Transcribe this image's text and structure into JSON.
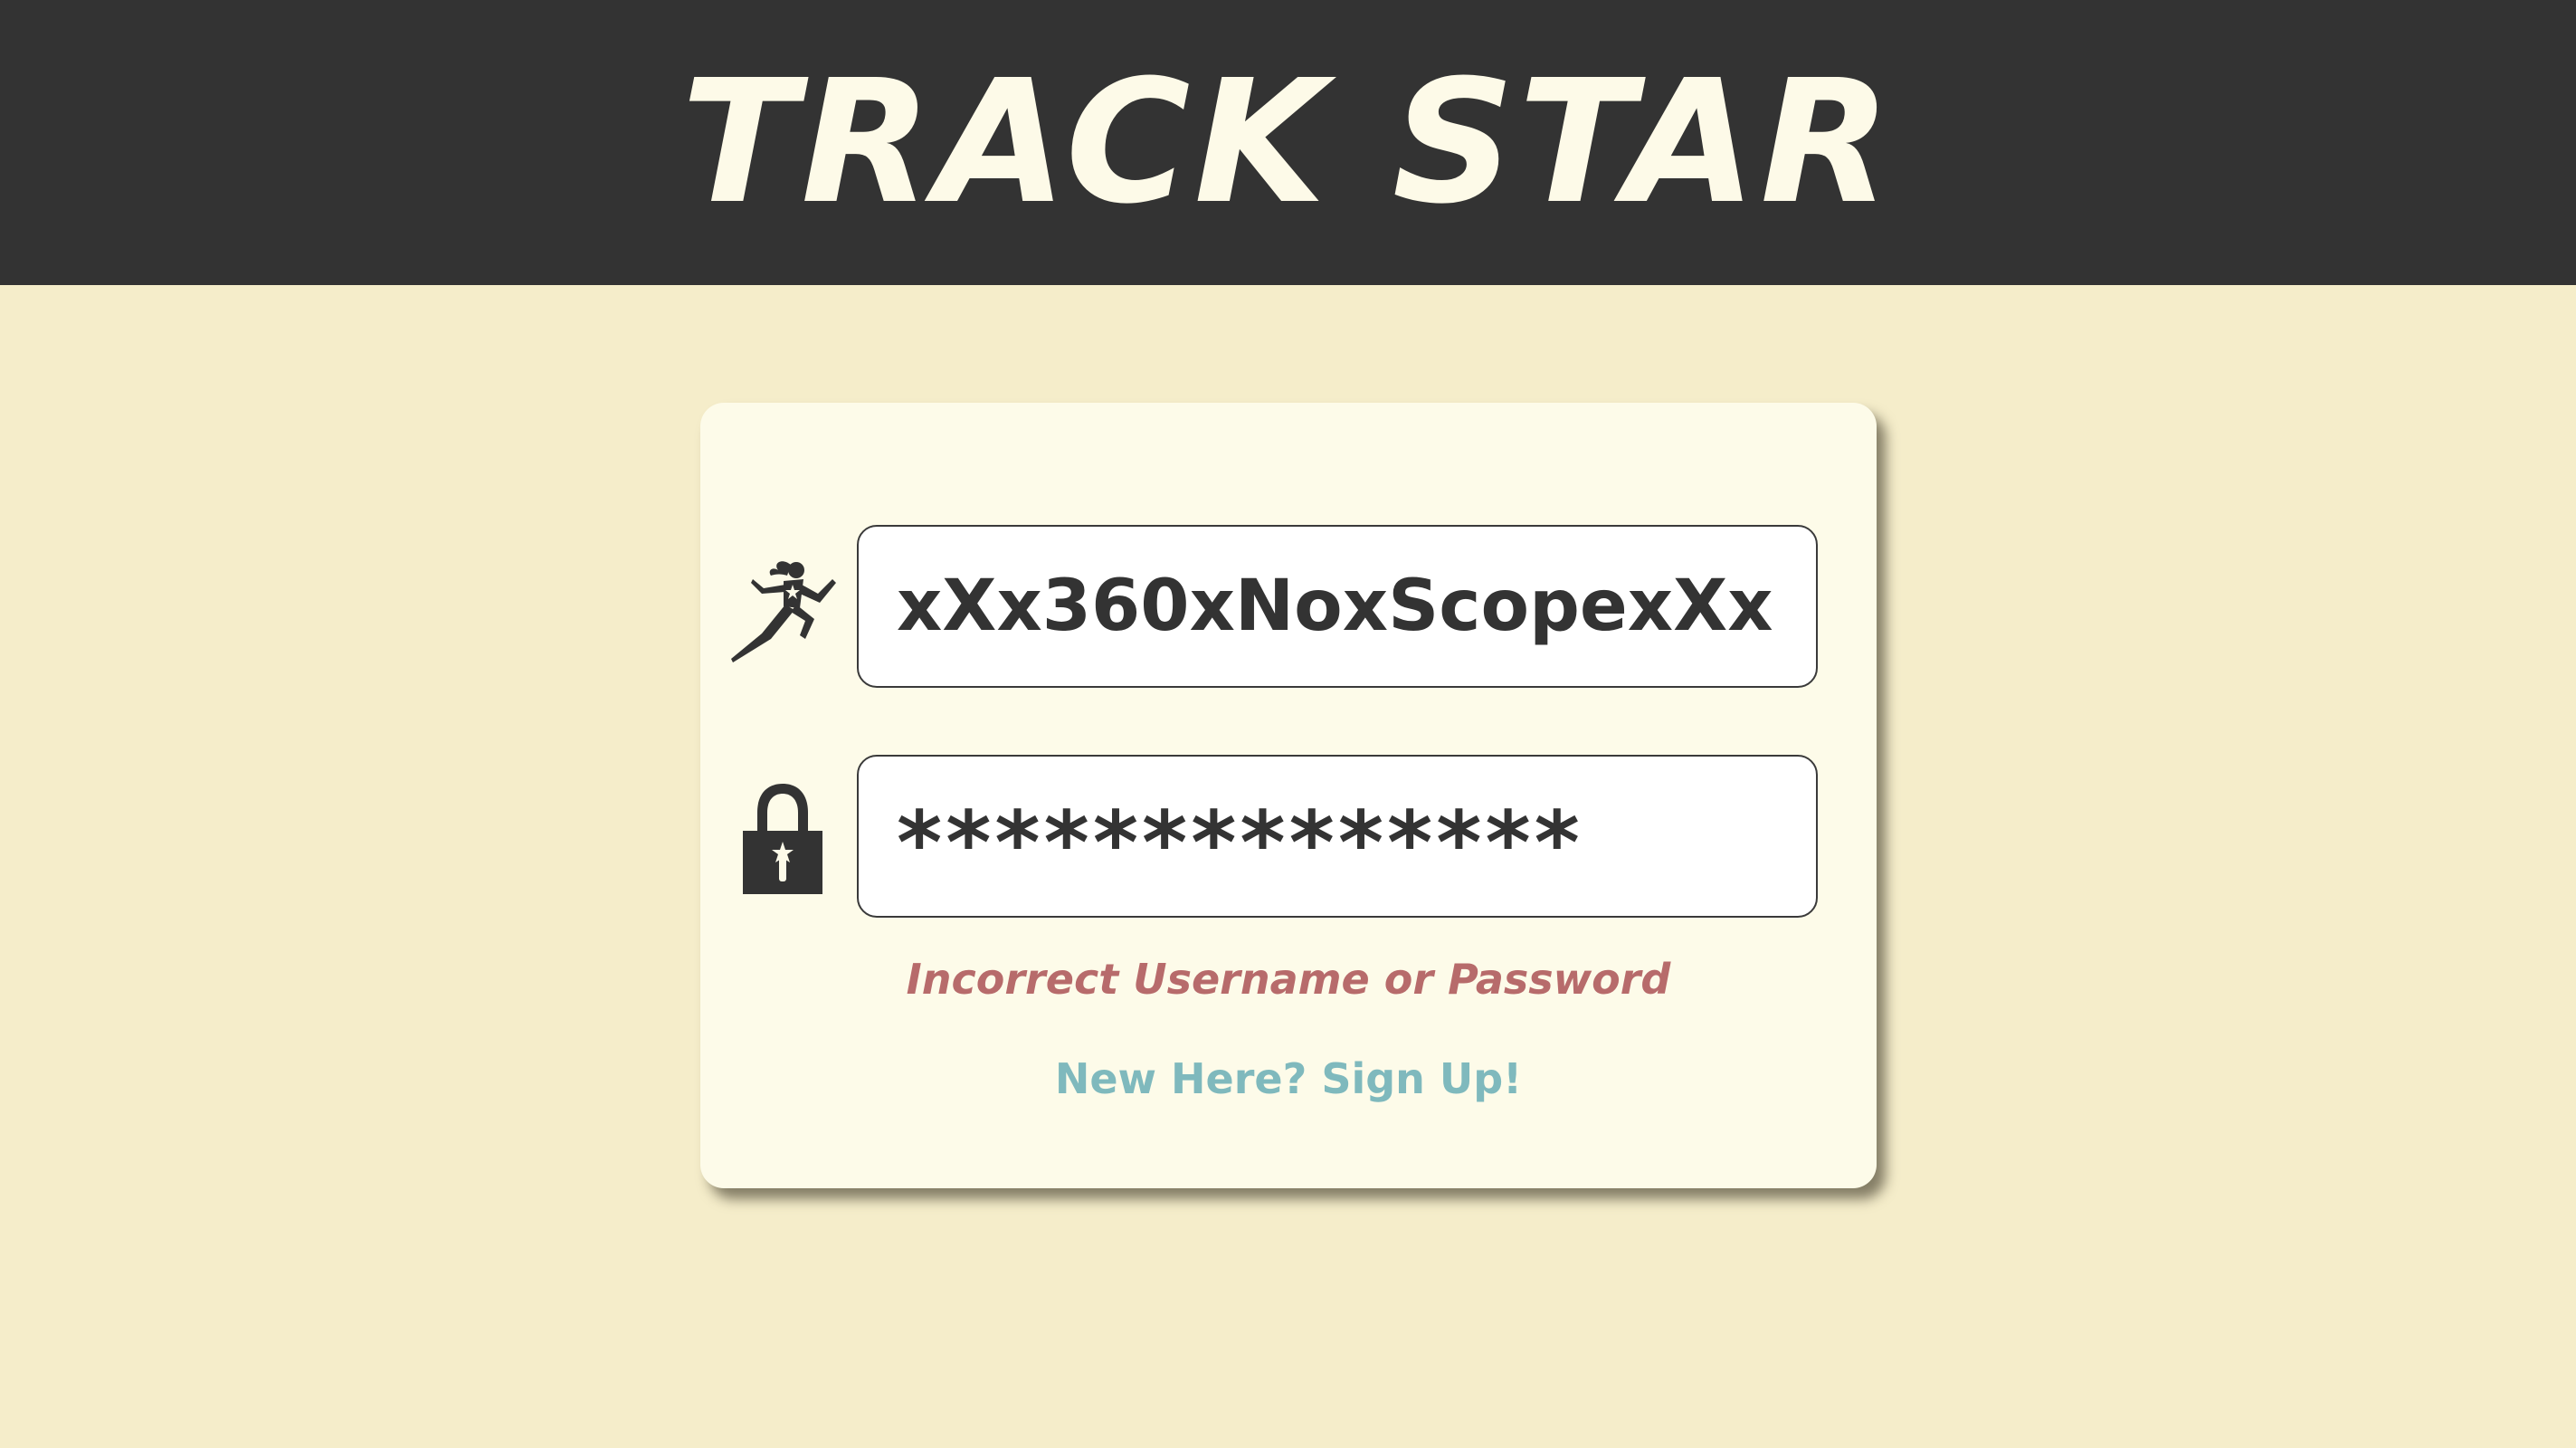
{
  "header": {
    "title": "TRACK STAR"
  },
  "login": {
    "username_value": "xXx360xNoxScopexXx",
    "password_value": "**************",
    "error_message": "Incorrect Username or Password",
    "signup_link": "New Here? Sign Up!"
  },
  "icons": {
    "username": "runner-icon",
    "password": "lock-icon"
  },
  "colors": {
    "header_bg": "#333333",
    "page_bg": "#f5edca",
    "card_bg": "#fdfbe9",
    "title_text": "#fdfae8",
    "error": "#b76b6b",
    "link": "#7fb9bd",
    "field_text": "#333333"
  }
}
